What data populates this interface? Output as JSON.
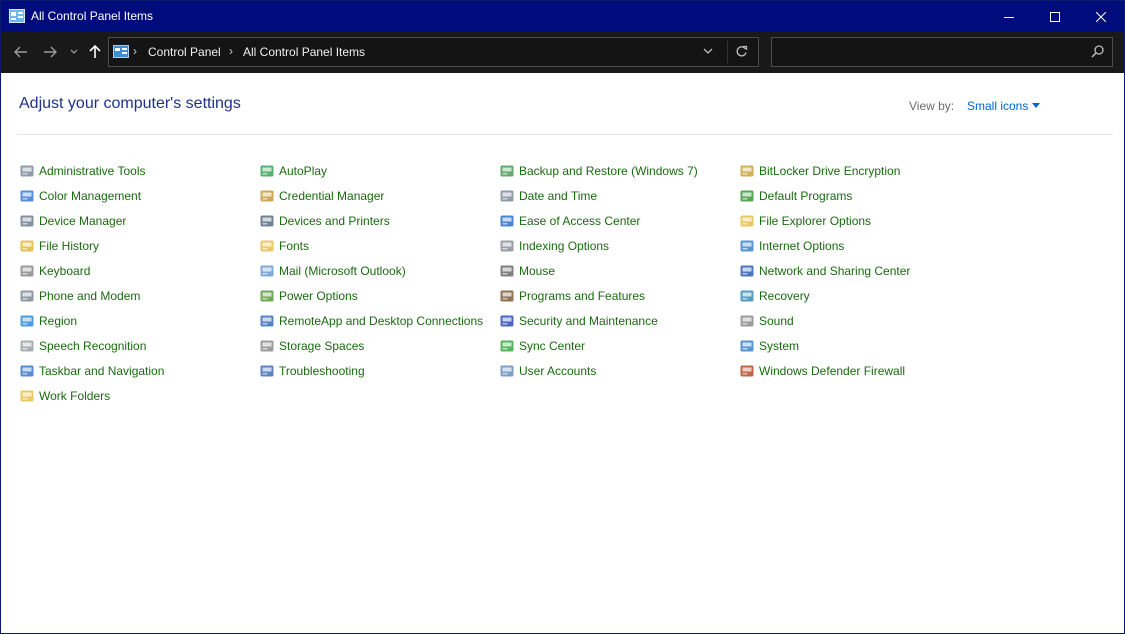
{
  "window": {
    "title": "All Control Panel Items"
  },
  "address": {
    "crumbs": [
      "Control Panel",
      "All Control Panel Items"
    ],
    "search_placeholder": ""
  },
  "header": {
    "heading": "Adjust your computer's settings",
    "view_by_label": "View by:",
    "view_by_value": "Small icons"
  },
  "items": [
    {
      "label": "Administrative Tools",
      "icon": "gears-icon"
    },
    {
      "label": "Color Management",
      "icon": "monitor-color-icon"
    },
    {
      "label": "Device Manager",
      "icon": "device-manager-icon"
    },
    {
      "label": "File History",
      "icon": "file-history-icon"
    },
    {
      "label": "Keyboard",
      "icon": "keyboard-icon"
    },
    {
      "label": "Phone and Modem",
      "icon": "phone-modem-icon"
    },
    {
      "label": "Region",
      "icon": "globe-icon"
    },
    {
      "label": "Speech Recognition",
      "icon": "microphone-icon"
    },
    {
      "label": "Taskbar and Navigation",
      "icon": "taskbar-icon"
    },
    {
      "label": "Work Folders",
      "icon": "work-folders-icon"
    },
    {
      "label": "AutoPlay",
      "icon": "autoplay-icon"
    },
    {
      "label": "Credential Manager",
      "icon": "vault-icon"
    },
    {
      "label": "Devices and Printers",
      "icon": "printer-icon"
    },
    {
      "label": "Fonts",
      "icon": "fonts-icon"
    },
    {
      "label": "Mail (Microsoft Outlook)",
      "icon": "mail-icon"
    },
    {
      "label": "Power Options",
      "icon": "power-icon"
    },
    {
      "label": "RemoteApp and Desktop Connections",
      "icon": "remote-desktop-icon"
    },
    {
      "label": "Storage Spaces",
      "icon": "storage-icon"
    },
    {
      "label": "Troubleshooting",
      "icon": "troubleshooting-icon"
    },
    {
      "label": "Backup and Restore (Windows 7)",
      "icon": "backup-icon"
    },
    {
      "label": "Date and Time",
      "icon": "clock-icon"
    },
    {
      "label": "Ease of Access Center",
      "icon": "ease-of-access-icon"
    },
    {
      "label": "Indexing Options",
      "icon": "indexing-icon"
    },
    {
      "label": "Mouse",
      "icon": "mouse-icon"
    },
    {
      "label": "Programs and Features",
      "icon": "programs-icon"
    },
    {
      "label": "Security and Maintenance",
      "icon": "flag-icon"
    },
    {
      "label": "Sync Center",
      "icon": "sync-icon"
    },
    {
      "label": "User Accounts",
      "icon": "users-icon"
    },
    {
      "label": "BitLocker Drive Encryption",
      "icon": "bitlocker-icon"
    },
    {
      "label": "Default Programs",
      "icon": "default-programs-icon"
    },
    {
      "label": "File Explorer Options",
      "icon": "folder-options-icon"
    },
    {
      "label": "Internet Options",
      "icon": "internet-icon"
    },
    {
      "label": "Network and Sharing Center",
      "icon": "network-icon"
    },
    {
      "label": "Recovery",
      "icon": "recovery-icon"
    },
    {
      "label": "Sound",
      "icon": "speaker-icon"
    },
    {
      "label": "System",
      "icon": "system-icon"
    },
    {
      "label": "Windows Defender Firewall",
      "icon": "firewall-icon"
    }
  ],
  "colors": {
    "title_bar": "#000c7b",
    "nav_bar": "#191919",
    "heading": "#1e3287",
    "link": "#1a6a10",
    "view_by_value": "#0066cc"
  }
}
